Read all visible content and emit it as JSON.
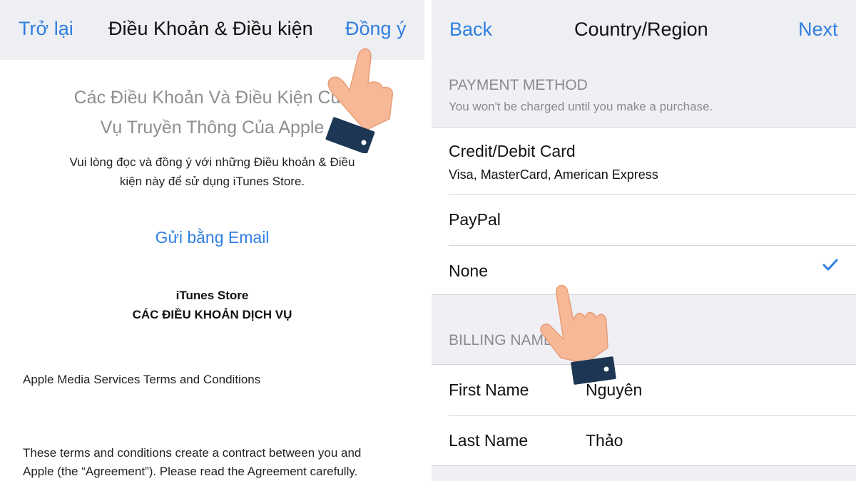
{
  "left_screen": {
    "nav": {
      "back_label": "Trở lại",
      "title": "Điều Khoản & Điều kiện",
      "agree_label": "Đồng ý"
    },
    "heading_line1": "Các Điều Khoản Và Điều Kiện Của",
    "heading_line2": "Vụ Truyền Thông Của Apple",
    "intro_line1": "Vui lòng đọc và đồng ý với những Điều khoản & Điều",
    "intro_line2": "kiện này để sử dụng iTunes Store.",
    "email_link": "Gửi bằng Email",
    "store_title": "iTunes Store",
    "store_subtitle": "CÁC ĐIỀU KHOẢN DỊCH VỤ",
    "terms_name": "Apple Media Services Terms and Conditions",
    "terms_body_line1": "These terms and conditions create a contract between you and",
    "terms_body_line2": "Apple (the “Agreement”). Please read the Agreement carefully."
  },
  "right_screen": {
    "nav": {
      "back_label": "Back",
      "title": "Country/Region",
      "next_label": "Next"
    },
    "payment_section": {
      "header": "PAYMENT METHOD",
      "subheader": "You won't be charged until you make a purchase.",
      "options": [
        {
          "label": "Credit/Debit Card",
          "detail": "Visa, MasterCard, American Express",
          "selected": false
        },
        {
          "label": "PayPal",
          "selected": false
        },
        {
          "label": "None",
          "selected": true
        }
      ]
    },
    "billing_section": {
      "header": "BILLING NAME",
      "fields": [
        {
          "label": "First Name",
          "value": "Nguyên"
        },
        {
          "label": "Last Name",
          "value": "Thảo"
        }
      ]
    }
  },
  "colors": {
    "accent_blue": "#2f7ee0",
    "nav_background": "#eeeff3",
    "grouped_background": "#efeff4",
    "secondary_text": "#8a8a8f",
    "hand_skin": "#f6b896",
    "hand_cuff": "#1c3654"
  },
  "icons": [
    "checkmark-icon",
    "pointing-hand-icon"
  ]
}
